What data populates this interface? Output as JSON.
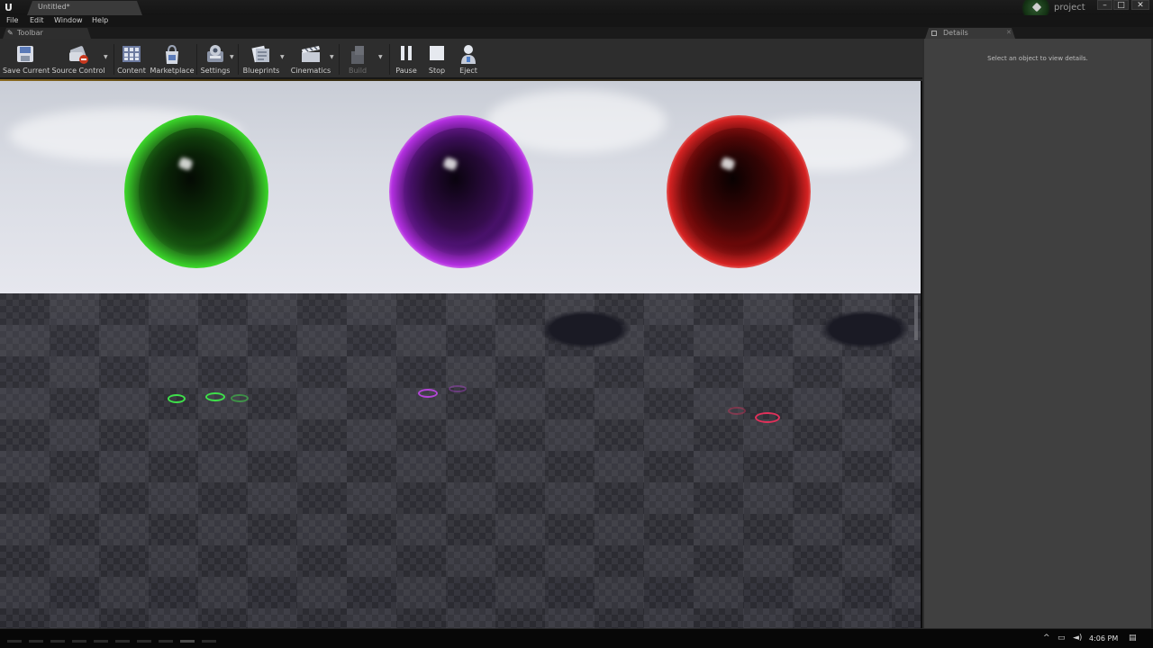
{
  "window": {
    "doc_tab": "Untitled*",
    "project_name": "project",
    "controls": {
      "minimize": "–",
      "maximize": "□",
      "close": "✕"
    }
  },
  "menu": {
    "items": [
      "File",
      "Edit",
      "Window",
      "Help"
    ]
  },
  "toolbar_panel": {
    "tab_label": "Toolbar"
  },
  "toolbar": {
    "buttons": [
      {
        "label": "Save Current",
        "icon": "save-icon"
      },
      {
        "label": "Source Control",
        "icon": "source-control-icon"
      },
      {
        "label": "Content",
        "icon": "content-icon"
      },
      {
        "label": "Marketplace",
        "icon": "marketplace-icon"
      },
      {
        "label": "Settings",
        "icon": "settings-icon"
      },
      {
        "label": "Blueprints",
        "icon": "blueprints-icon"
      },
      {
        "label": "Cinematics",
        "icon": "cinematics-icon"
      },
      {
        "label": "Build",
        "icon": "build-icon",
        "disabled": true
      },
      {
        "label": "Pause",
        "icon": "pause-icon"
      },
      {
        "label": "Stop",
        "icon": "stop-icon"
      },
      {
        "label": "Eject",
        "icon": "eject-icon"
      }
    ]
  },
  "details": {
    "tab_label": "Details",
    "empty_message": "Select an object to view details."
  },
  "taskbar": {
    "clock": "4:06 PM"
  }
}
